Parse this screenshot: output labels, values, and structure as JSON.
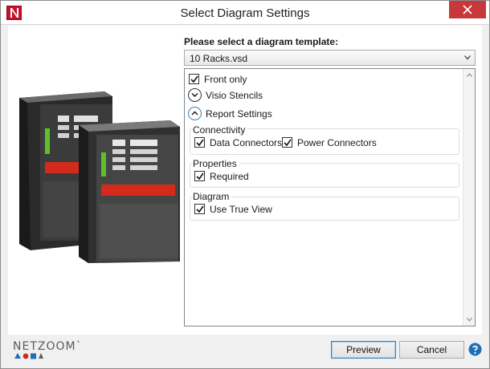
{
  "window": {
    "title": "Select Diagram Settings",
    "app_icon": "netzoom-n-icon",
    "close_icon": "close-icon"
  },
  "template": {
    "label": "Please select a diagram template:",
    "selected": "10 Racks.vsd"
  },
  "options": {
    "front_only": {
      "label": "Front only",
      "checked": true
    },
    "visio_stencils": {
      "label": "Visio Stencils",
      "expanded": false
    },
    "report_settings": {
      "label": "Report Settings",
      "expanded": true
    }
  },
  "groups": {
    "connectivity": {
      "title": "Connectivity",
      "data_connectors": {
        "label": "Data Connectors",
        "checked": true
      },
      "power_connectors": {
        "label": "Power Connectors",
        "checked": true
      }
    },
    "properties": {
      "title": "Properties",
      "required": {
        "label": "Required",
        "checked": true
      }
    },
    "diagram": {
      "title": "Diagram",
      "use_true_view": {
        "label": "Use True View",
        "checked": true
      }
    }
  },
  "footer": {
    "logo_text": "NETZOOM`",
    "preview_label": "Preview",
    "cancel_label": "Cancel",
    "help_icon": "help-icon"
  },
  "colors": {
    "close_button": "#c7383a",
    "accent": "#1e6fb7",
    "rack_red": "#d42a1c",
    "rack_green": "#5fbf2b"
  }
}
